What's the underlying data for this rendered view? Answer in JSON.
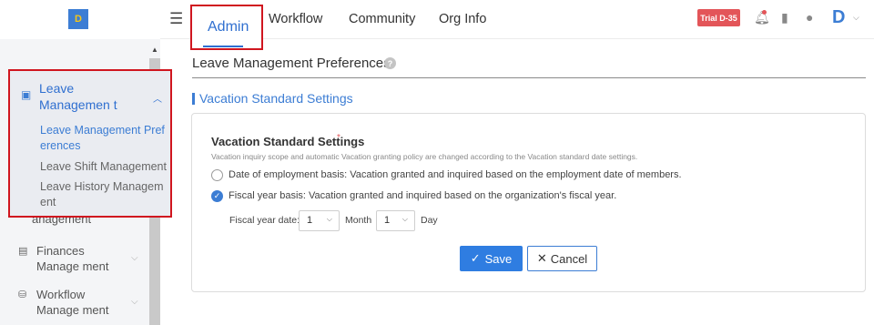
{
  "logo": {
    "text": "D"
  },
  "sidebar": {
    "leave_group": {
      "label": "Leave Managemen t",
      "items": [
        {
          "label": "Leave Management Pref erences",
          "active": true
        },
        {
          "label": "Leave Shift Management",
          "active": false
        },
        {
          "label": "Leave History Managem ent",
          "active": false
        }
      ]
    },
    "hidden_item_label": "anagement",
    "groups": [
      {
        "label": "Finances Manage ment"
      },
      {
        "label": "Workflow Manage ment"
      }
    ]
  },
  "header": {
    "tabs": [
      {
        "label": "Admin",
        "active": true
      },
      {
        "label": "Workflow"
      },
      {
        "label": "Community"
      },
      {
        "label": "Org Info"
      }
    ],
    "trial_badge": "Trial D-35",
    "avatar_text": "D"
  },
  "page": {
    "title": "Leave Management Preferences",
    "help_mark": "?",
    "section_title": "Vacation Standard Settings"
  },
  "settings": {
    "title": "Vacation Standard Settings",
    "required_mark": "*",
    "description": "Vacation inquiry scope and automatic Vacation granting policy are changed according to the Vacation standard date settings.",
    "options": [
      {
        "label": "Date of employment basis: Vacation granted and inquired based on the employment date of members.",
        "selected": false
      },
      {
        "label": "Fiscal year basis: Vacation granted and inquired based on the organization's fiscal year.",
        "selected": true
      }
    ],
    "fiscal": {
      "label": "Fiscal year date:",
      "month_value": "1",
      "month_label": "Month",
      "day_value": "1",
      "day_label": "Day"
    }
  },
  "actions": {
    "save": "Save",
    "cancel": "Cancel"
  },
  "colors": {
    "primary": "#2f7de1",
    "highlight_border": "#d0161f",
    "trial": "#e35559"
  }
}
